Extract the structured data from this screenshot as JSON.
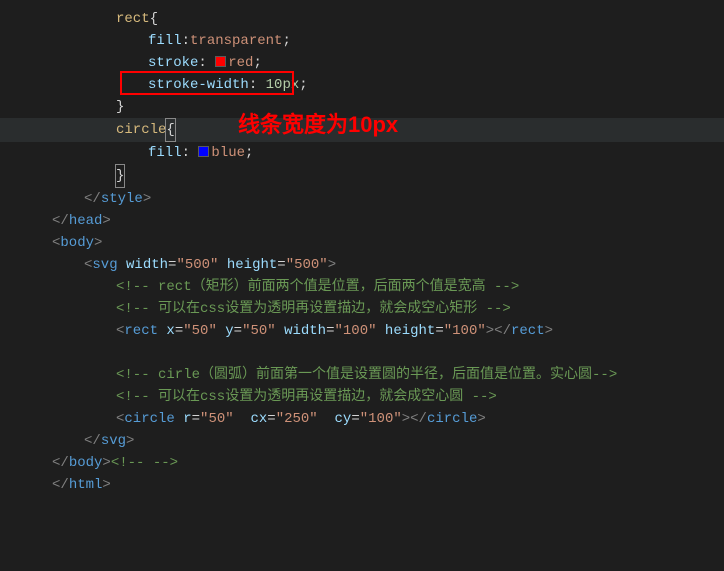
{
  "code": {
    "rect_sel": "rect",
    "fill": "fill",
    "transparent": "transparent",
    "stroke": "stroke",
    "red": "red",
    "strokewidth": "stroke-width",
    "ten": "10",
    "px": "px",
    "circle_sel": "circle",
    "blue": "blue",
    "style_close": "style",
    "head_close": "head",
    "body_open": "body",
    "svg": "svg",
    "width": "width",
    "height": "height",
    "v500": "\"500\"",
    "cmt_rect": "<!-- rect（矩形）前面两个值是位置，后面两个值是宽高 -->",
    "cmt_rect_css": "<!-- 可以在css设置为透明再设置描边，就会成空心矩形 -->",
    "rect_tag": "rect",
    "x": "x",
    "y": "y",
    "v50": "\"50\"",
    "v100": "\"100\"",
    "cmt_circle": "<!-- cirle（圆弧）前面第一个值是设置圆的半径，后面值是位置。实心圆-->",
    "cmt_circle_css": "<!-- 可以在css设置为透明再设置描边，就会成空心圆 -->",
    "circle_tag": "circle",
    "r": "r",
    "cx": "cx",
    "cy": "cy",
    "v250": "\"250\"",
    "body_close": "body",
    "html_close": "html",
    "empty_cmt": "<!-- -->"
  },
  "annotation": {
    "text": "线条宽度为10px"
  }
}
